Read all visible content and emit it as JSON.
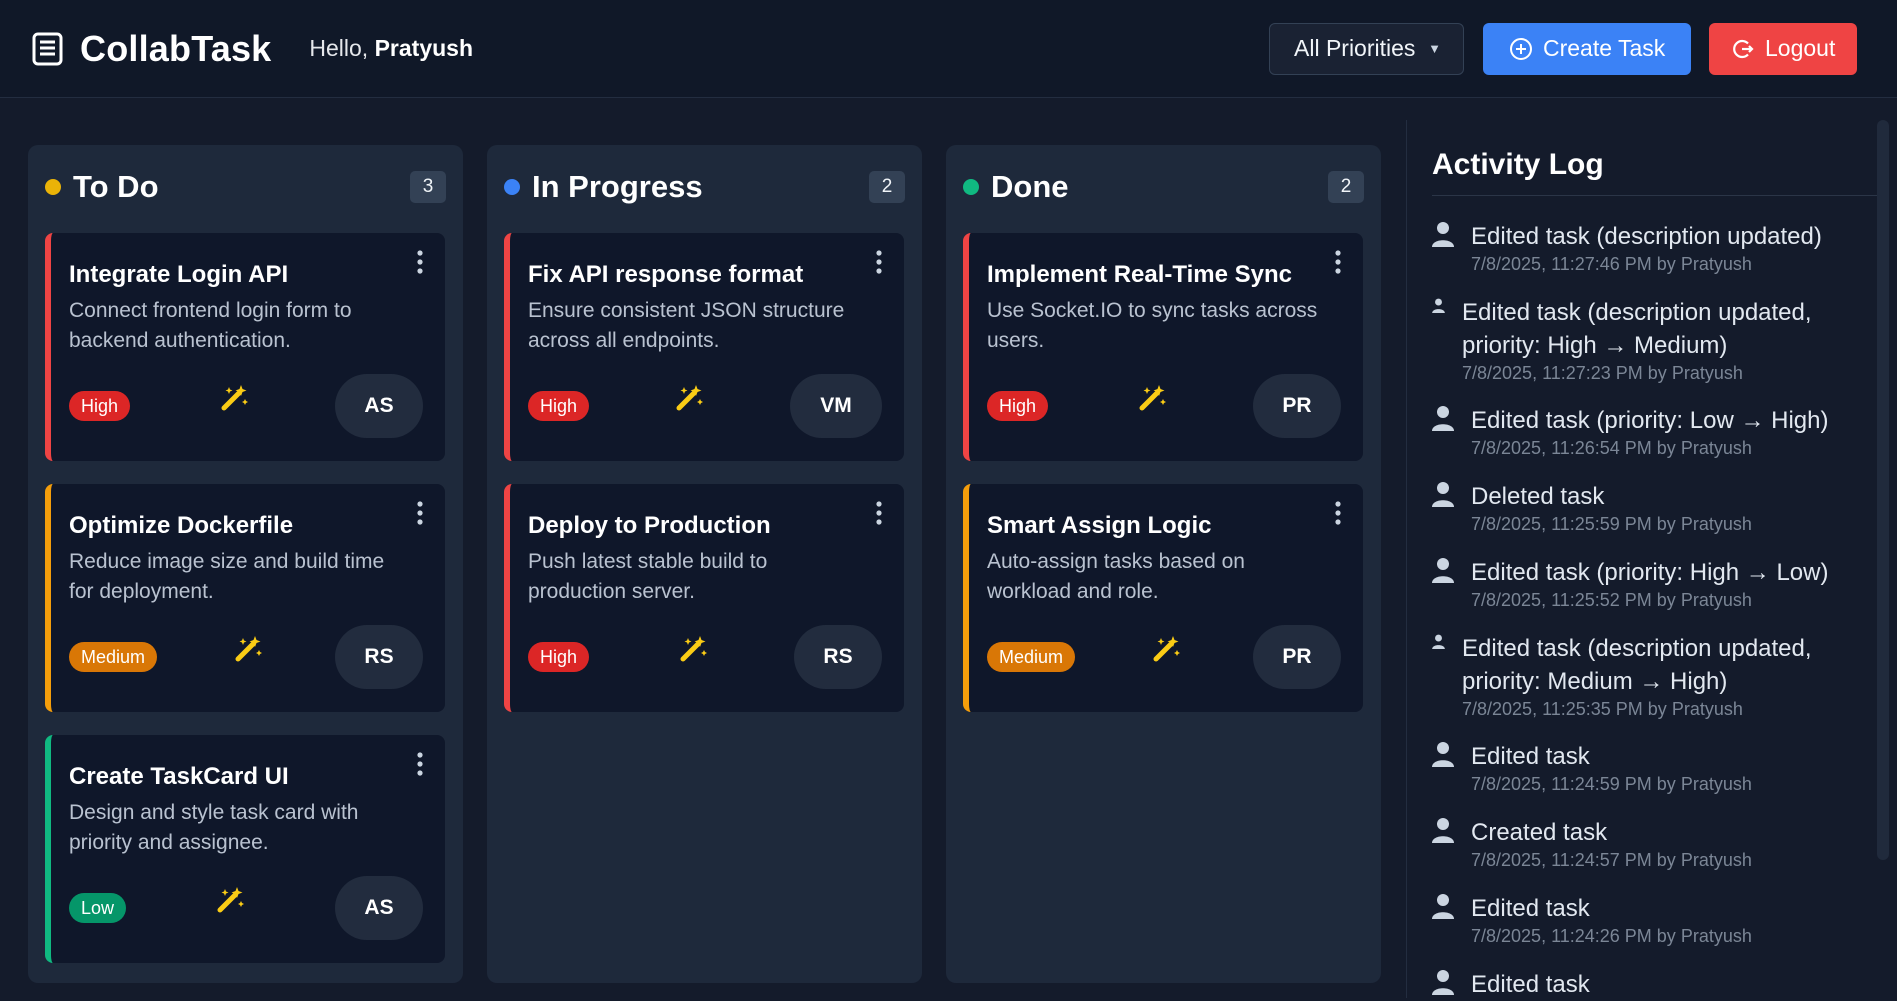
{
  "header": {
    "brand": "CollabTask",
    "greeting_prefix": "Hello, ",
    "user_name": "Pratyush",
    "priority_filter": "All Priorities",
    "create_label": "Create Task",
    "logout_label": "Logout"
  },
  "colors": {
    "high": "#dc2626",
    "medium": "#d97706",
    "low": "#059669",
    "todo_dot": "#eab308",
    "progress_dot": "#3b82f6",
    "done_dot": "#10b981"
  },
  "columns": [
    {
      "title": "To Do",
      "count": "3",
      "cards": [
        {
          "title": "Integrate Login API",
          "desc": "Connect frontend login form to backend authentication.",
          "priority": "High",
          "assignee": "AS"
        },
        {
          "title": "Optimize Dockerfile",
          "desc": "Reduce image size and build time for deployment.",
          "priority": "Medium",
          "assignee": "RS"
        },
        {
          "title": "Create TaskCard UI",
          "desc": "Design and style task card with priority and assignee.",
          "priority": "Low",
          "assignee": "AS"
        }
      ]
    },
    {
      "title": "In Progress",
      "count": "2",
      "cards": [
        {
          "title": "Fix API response format",
          "desc": "Ensure consistent JSON structure across all endpoints.",
          "priority": "High",
          "assignee": "VM"
        },
        {
          "title": "Deploy to Production",
          "desc": "Push latest stable build to production server.",
          "priority": "High",
          "assignee": "RS"
        }
      ]
    },
    {
      "title": "Done",
      "count": "2",
      "cards": [
        {
          "title": "Implement Real-Time Sync",
          "desc": "Use Socket.IO to sync tasks across users.",
          "priority": "High",
          "assignee": "PR"
        },
        {
          "title": "Smart Assign Logic",
          "desc": "Auto-assign tasks based on workload and role.",
          "priority": "Medium",
          "assignee": "PR"
        }
      ]
    }
  ],
  "activity": {
    "title": "Activity Log",
    "items": [
      {
        "text": "Edited task (description updated)",
        "meta": "7/8/2025, 11:27:46 PM by Pratyush"
      },
      {
        "text": "Edited task (description updated, priority: High → Medium)",
        "meta": "7/8/2025, 11:27:23 PM by Pratyush"
      },
      {
        "text": "Edited task (priority: Low → High)",
        "meta": "7/8/2025, 11:26:54 PM by Pratyush"
      },
      {
        "text": "Deleted task",
        "meta": "7/8/2025, 11:25:59 PM by Pratyush"
      },
      {
        "text": "Edited task (priority: High → Low)",
        "meta": "7/8/2025, 11:25:52 PM by Pratyush"
      },
      {
        "text": "Edited task (description updated, priority: Medium → High)",
        "meta": "7/8/2025, 11:25:35 PM by Pratyush"
      },
      {
        "text": "Edited task",
        "meta": "7/8/2025, 11:24:59 PM by Pratyush"
      },
      {
        "text": "Created task",
        "meta": "7/8/2025, 11:24:57 PM by Pratyush"
      },
      {
        "text": "Edited task",
        "meta": "7/8/2025, 11:24:26 PM by Pratyush"
      },
      {
        "text": "Edited task",
        "meta": ""
      }
    ]
  }
}
